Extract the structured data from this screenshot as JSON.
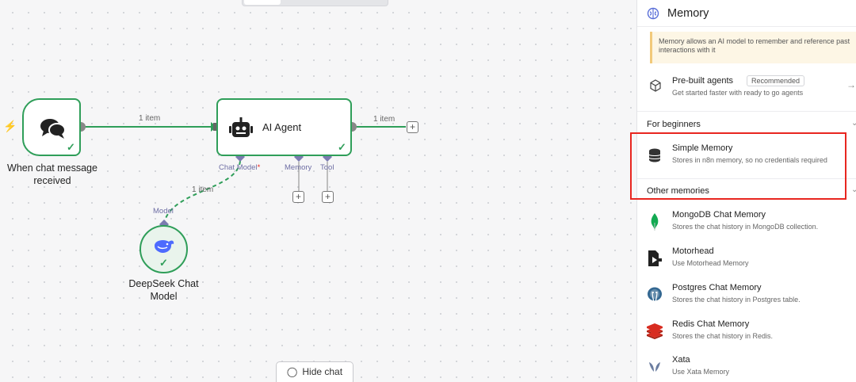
{
  "canvas": {
    "edges": {
      "main_item_label": "1 item",
      "out_item_label": "1 item",
      "model_item_label": "1 item"
    },
    "nodes": {
      "trigger": {
        "label_line1": "When chat message",
        "label_line2": "received"
      },
      "agent": {
        "title": "AI Agent"
      },
      "deepseek": {
        "label_line1": "DeepSeek Chat",
        "label_line2": "Model"
      }
    },
    "ports": {
      "chat_model": "Chat Model",
      "chat_model_required": "*",
      "memory": "Memory",
      "tool": "Tool",
      "model": "Model"
    },
    "hide_chat_label": "Hide chat",
    "colors": {
      "success": "#2f9e59",
      "port": "#7b7bb0",
      "trigger_bolt": "#ff6f5c"
    }
  },
  "panel": {
    "title": "Memory",
    "notice": "Memory allows an AI model to remember and reference past interactions with it",
    "prebuilt": {
      "title": "Pre-built agents",
      "badge": "Recommended",
      "desc": "Get started faster with ready to go agents"
    },
    "sections": {
      "beginners": "For beginners",
      "other": "Other memories"
    },
    "beginner_items": [
      {
        "name": "Simple Memory",
        "desc": "Stores in n8n memory, so no credentials required",
        "icon": "database-icon"
      }
    ],
    "other_items": [
      {
        "name": "MongoDB Chat Memory",
        "desc": "Stores the chat history in MongoDB collection.",
        "icon": "mongodb-icon"
      },
      {
        "name": "Motorhead",
        "desc": "Use Motorhead Memory",
        "icon": "motorhead-icon"
      },
      {
        "name": "Postgres Chat Memory",
        "desc": "Stores the chat history in Postgres table.",
        "icon": "postgres-icon"
      },
      {
        "name": "Redis Chat Memory",
        "desc": "Stores the chat history in Redis.",
        "icon": "redis-icon"
      },
      {
        "name": "Xata",
        "desc": "Use Xata Memory",
        "icon": "xata-icon"
      }
    ],
    "highlight_color": "#e8261f"
  }
}
